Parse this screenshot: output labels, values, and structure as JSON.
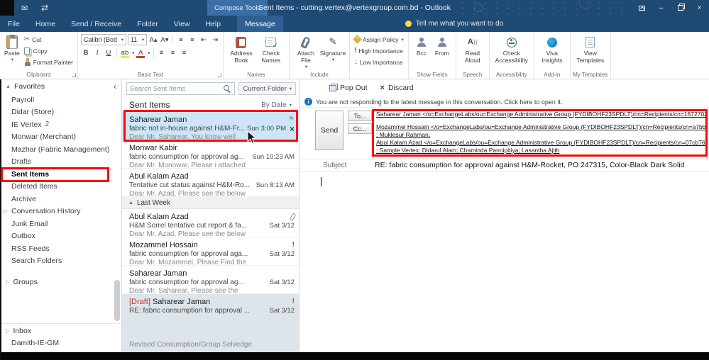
{
  "colors": {
    "titlebar": "#1f4a73",
    "active_tab": "#2f6094",
    "selection": "#cde6f7",
    "annotation": "#ff0000",
    "draft_label": "#c0392b",
    "count_badge": "#0f6cbd",
    "important": "#c0392b"
  },
  "icons": {
    "dropdown": "▾",
    "collapse_left": "‹",
    "expand_right": "▷",
    "section_expanded": "▲",
    "flag": "⚑",
    "close": "×",
    "important": "!",
    "low_importance": "↓",
    "grow_font": "A▴",
    "shrink_font": "A▾",
    "list_lines": "≡",
    "indent_left": "⇤",
    "indent_right": "⇥",
    "scissors": "✂",
    "signature_pen": "✎",
    "envelope": "✉",
    "send_receive": "⇄",
    "minimize": "–",
    "info": "i",
    "bold": "B",
    "italic": "I",
    "underline": "U",
    "highlight": "ab",
    "font_color": "A"
  },
  "titlebar": {
    "contextual_tab_label": "Compose Tools",
    "title": "Sent Items - cutting.vertex@vertexgroup.com.bd - Outlook"
  },
  "tabs": {
    "items": [
      "File",
      "Home",
      "Send / Receive",
      "Folder",
      "View",
      "Help",
      "Message"
    ],
    "tell_me": "Tell me what you want to do"
  },
  "ribbon": {
    "clipboard": {
      "paste": "Paste",
      "cut": "Cut",
      "copy": "Copy",
      "format_painter": "Format Painter",
      "label": "Clipboard"
    },
    "basic_text": {
      "font_name": "Calibri (Bod",
      "font_size": "11",
      "label": "Basic Text"
    },
    "names": {
      "address_book": "Address Book",
      "check_names": "Check Names",
      "label": "Names"
    },
    "include": {
      "attach_file": "Attach File",
      "signature": "Signature",
      "label": "Include"
    },
    "tags": {
      "assign_policy": "Assign Policy",
      "high_importance": "High Importance",
      "low_importance": "Low Importance"
    },
    "show_fields": {
      "bcc": "Bcc",
      "from": "From",
      "label": "Show Fields"
    },
    "speech": {
      "read_aloud": "Read Aloud",
      "label": "Speech"
    },
    "accessibility": {
      "check_accessibility": "Check Accessibility",
      "label": "Accessibility"
    },
    "addin": {
      "viva_insights": "Viva Insights",
      "label": "Add-in"
    },
    "templates": {
      "view_templates": "View Templates",
      "label": "My Templates"
    }
  },
  "sidebar": {
    "favorites_label": "Favorites",
    "items": [
      {
        "label": "Payroll"
      },
      {
        "label": "Didar (Store)"
      },
      {
        "label": "IE Vertex",
        "count": "2"
      },
      {
        "label": "Monwar (Merchant)"
      },
      {
        "label": "Mazhar (Fabric Management)"
      },
      {
        "label": "Drafts"
      },
      {
        "label": "Sent Items"
      },
      {
        "label": "Deleted Items"
      },
      {
        "label": "Archive"
      },
      {
        "label": "Conversation History"
      },
      {
        "label": "Junk Email"
      },
      {
        "label": "Outbox"
      },
      {
        "label": "RSS Feeds"
      },
      {
        "label": "Search Folders"
      }
    ],
    "groups_label": "Groups",
    "inbox_label": "Inbox",
    "account_folder": "Damith-IE-GM"
  },
  "list": {
    "search_placeholder": "Search Sent Items",
    "scope": "Current Folder",
    "header": "Sent Items",
    "sort": "By Date",
    "section_last_week": "Last Week",
    "emails": [
      {
        "sender": "Saharear Jaman",
        "subject": "fabric not in-house against H&M-Fr...",
        "date": "Sun 3:00 PM",
        "preview": "Dear Mr. Saharear,  You know well"
      },
      {
        "sender": "Monwar Kabir",
        "subject": "fabric consumption for approval ag...",
        "date": "Sun 10:23 AM",
        "preview": "Dear Mr. Monowar,  Please i attached"
      },
      {
        "sender": "Abul Kalam Azad",
        "subject": "Tentative cut status against H&M-Ro...",
        "date": "Sun 8:13 AM",
        "preview": "Dear Mr. Azad,  Please see the below"
      },
      {
        "sender": "Abul Kalam Azad",
        "subject": "H&M Sorrel tentative cut report & fa...",
        "date": "Sat 3/12",
        "preview": "Dear Mr. Azad,  Please see the below"
      },
      {
        "sender": "Mozammel Hossain",
        "subject": "fabric consumption for approval aga...",
        "date": "Sat 3/12",
        "preview": "Dear Mr. Mozammel,  Please Find the"
      },
      {
        "sender": "Saharear Jaman",
        "subject": "fabric consumption for approval ag...",
        "date": "Sat 3/12",
        "preview": "Dear Mr. Saharear,  Please see the"
      },
      {
        "prefix": "[Draft]",
        "sender": "Saharear Jaman",
        "subject": "RE: fabric consumption for approval ...",
        "date": "Sat 3/12",
        "preview": "Revised Consumption/Group Selvedge"
      }
    ]
  },
  "compose": {
    "pop_out": "Pop Out",
    "discard": "Discard",
    "info_text": "You are not responding to the latest message in this conversation. Click here to open it.",
    "send": "Send",
    "to_label": "To...",
    "cc_label": "Cc...",
    "to_value": "Saharear  Jaman </o=ExchangeLabs/ou=Exchange Administrative Group (FYDIBOHF23SPDLT)/cn=Recipients/cn=1672702...",
    "cc_line1": "Mozammel Hossain </o=ExchangeLabs/ou=Exchange Administrative Group (FYDIBOHF23SPDLT)/cn=Recipients/cn=a7bb...",
    "cc_line2": "; Muklesur Rahman;",
    "cc_line3": "Abul Kalam Azad </o=ExchangeLabs/ou=Exchange Administrative Group (FYDIBOHF23SPDLT)/cn=Recipients/cn=07cb766...",
    "cc_line4": "; Sample Vertex; Didarul Alam; Chaminda Pannipitiya; Lasantha Ajith",
    "subject_label": "Subject",
    "subject_value": "RE: fabric consumption for approval against H&M-Rocket, PO 247315, Color-Black Dark Solid"
  }
}
